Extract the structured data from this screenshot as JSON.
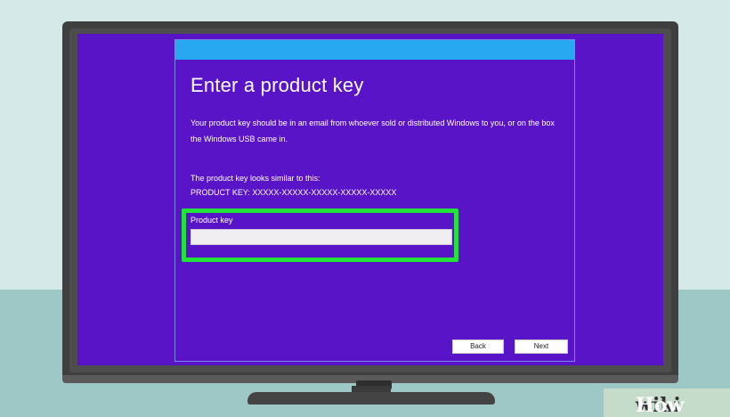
{
  "dialog": {
    "title": "Enter a product key",
    "description": "Your product key should be in an email from whoever sold or distributed Windows to you, or on the box the Windows USB came in.",
    "hint_line1": "The product key looks similar to this:",
    "hint_line2": "PRODUCT KEY: XXXXX-XXXXX-XXXXX-XXXXX-XXXXX",
    "field_label": "Product key",
    "field_value": "",
    "back_label": "Back",
    "next_label": "Next"
  },
  "watermark": {
    "wiki": "wiki",
    "how": "How"
  },
  "colors": {
    "screen": "#5a14c8",
    "title_bar": "#28a8f0",
    "highlight": "#22e33c"
  }
}
